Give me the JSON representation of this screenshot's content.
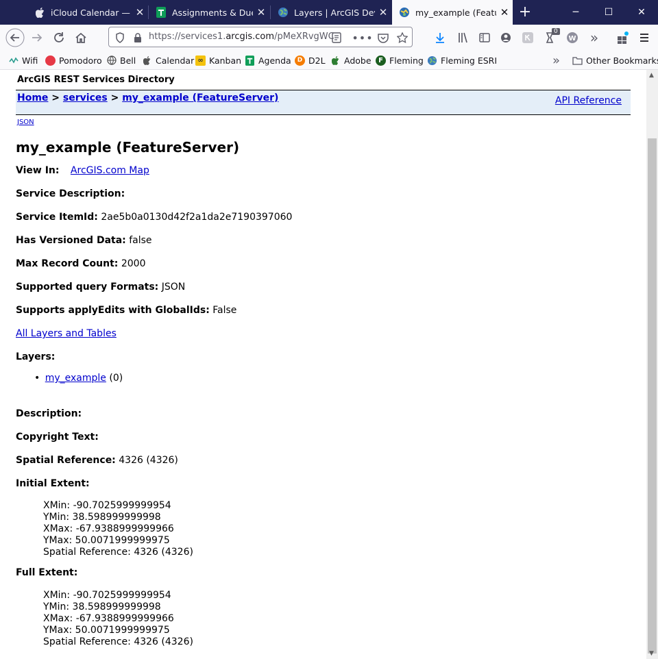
{
  "tabs": [
    {
      "title": "iCloud Calendar — Ea",
      "icon": "apple-icon"
    },
    {
      "title": "Assignments & Due D",
      "icon": "sheets-icon"
    },
    {
      "title": "Layers | ArcGIS Develo",
      "icon": "globe-icon"
    },
    {
      "title": "my_example (FeatureS",
      "icon": "arcgis-icon",
      "active": true
    }
  ],
  "window_controls": {
    "minimize": "─",
    "maximize": "☐",
    "close": "✕"
  },
  "url": {
    "prefix": "https://services1.",
    "domain": "arcgis.com",
    "rest": "/pMeXRvgWC"
  },
  "bookmarks": [
    {
      "label": "Wifi",
      "icon": "wifi-icon",
      "color": "#2a9d8f"
    },
    {
      "label": "Pomodoro",
      "icon": "tomato-icon",
      "color": "#e63946"
    },
    {
      "label": "Bell",
      "icon": "globe-icon",
      "color": "#555555"
    },
    {
      "label": "Calendar",
      "icon": "apple-icon",
      "color": "#555555"
    },
    {
      "label": "Kanban",
      "icon": "kanban-icon",
      "color": "#f4c20d"
    },
    {
      "label": "Agenda",
      "icon": "sheets-icon",
      "color": "#0f9d58"
    },
    {
      "label": "D2L",
      "icon": "d2l-icon",
      "color": "#f57c00"
    },
    {
      "label": "Adobe",
      "icon": "apple-icon",
      "color": "#2e7d32"
    },
    {
      "label": "Fleming",
      "icon": "fleming-icon",
      "color": "#1b5e20"
    },
    {
      "label": "Fleming ESRI",
      "icon": "globe-icon",
      "color": "#1565c0"
    }
  ],
  "other_bookmarks": "Other Bookmarks",
  "page": {
    "directory_title": "ArcGIS REST Services Directory",
    "breadcrumb": {
      "home": "Home",
      "sep": ">",
      "services": "services",
      "current": "my_example (FeatureServer)"
    },
    "api_reference": "API Reference",
    "json_link": "JSON",
    "heading": "my_example (FeatureServer)",
    "view_in_label": "View In:",
    "view_in_link": "ArcGIS.com Map",
    "service_description_label": "Service Description:",
    "service_itemid_label": "Service ItemId:",
    "service_itemid_value": "2ae5b0a0130d42f2a1da2e7190397060",
    "has_versioned_label": "Has Versioned Data:",
    "has_versioned_value": "false",
    "max_record_label": "Max Record Count:",
    "max_record_value": "2000",
    "supported_formats_label": "Supported query Formats:",
    "supported_formats_value": "JSON",
    "apply_edits_label": "Supports applyEdits with GlobalIds:",
    "apply_edits_value": "False",
    "all_layers_link": "All Layers and Tables",
    "layers_label": "Layers:",
    "layers": [
      {
        "name": "my_example",
        "id": "(0)"
      }
    ],
    "description_label": "Description:",
    "copyright_label": "Copyright Text:",
    "spatial_ref_label": "Spatial Reference:",
    "spatial_ref_value": "4326  (4326)",
    "initial_extent_label": "Initial Extent:",
    "initial_extent": {
      "xmin": "XMin: -90.7025999999954",
      "ymin": "YMin: 38.598999999998",
      "xmax": "XMax: -67.9388999999966",
      "ymax": "YMax: 50.0071999999975",
      "sr": "Spatial Reference: 4326  (4326)"
    },
    "full_extent_label": "Full Extent:",
    "full_extent": {
      "xmin": "XMin: -90.7025999999954",
      "ymin": "YMin: 38.598999999998",
      "xmax": "XMax: -67.9388999999966",
      "ymax": "YMax: 50.0071999999975",
      "sr": "Spatial Reference: 4326  (4326)"
    }
  },
  "toolbar_badge": "0"
}
